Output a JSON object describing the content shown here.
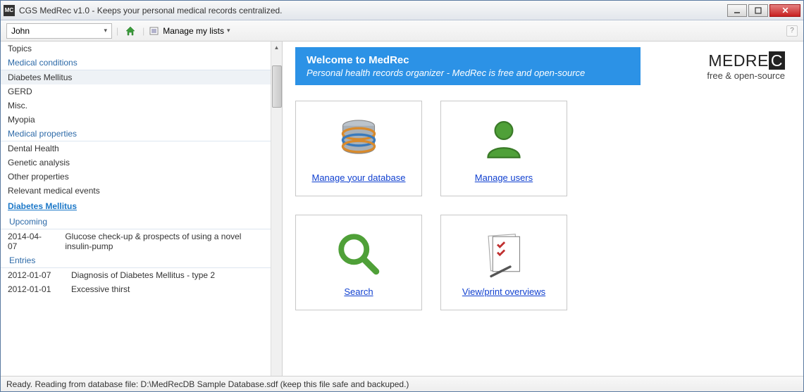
{
  "window": {
    "title": "CGS MedRec v1.0 - Keeps your personal medical records centralized."
  },
  "toolbar": {
    "user": "John",
    "manage_lists": "Manage my lists"
  },
  "sidebar": {
    "topics_label": "Topics",
    "medical_conditions_label": "Medical conditions",
    "conditions": [
      "Diabetes Mellitus",
      "GERD",
      "Misc.",
      "Myopia"
    ],
    "medical_properties_label": "Medical properties",
    "properties": [
      "Dental Health",
      "Genetic analysis",
      "Other properties",
      "Relevant medical events"
    ],
    "active_topic": "Diabetes Mellitus",
    "upcoming_label": "Upcoming",
    "upcoming": [
      {
        "date": "2014-04-07",
        "text": "Glucose check-up & prospects of using a novel insulin-pump"
      }
    ],
    "entries_label": "Entries",
    "entries": [
      {
        "date": "2012-01-07",
        "text": "Diagnosis of Diabetes Mellitus - type 2"
      },
      {
        "date": "2012-01-01",
        "text": "Excessive thirst"
      }
    ]
  },
  "banner": {
    "title": "Welcome to MedRec",
    "subtitle": "Personal health records organizer - MedRec is free and open-source"
  },
  "logo": {
    "main_prefix": "MEDRE",
    "main_suffix": "C",
    "tag": "free & open-source"
  },
  "tiles": {
    "database": "Manage your database",
    "users": "Manage users",
    "search": "Search",
    "overviews": "View/print overviews"
  },
  "status": "Ready. Reading from database file: D:\\MedRecDB Sample Database.sdf (keep this file safe and backuped.)"
}
